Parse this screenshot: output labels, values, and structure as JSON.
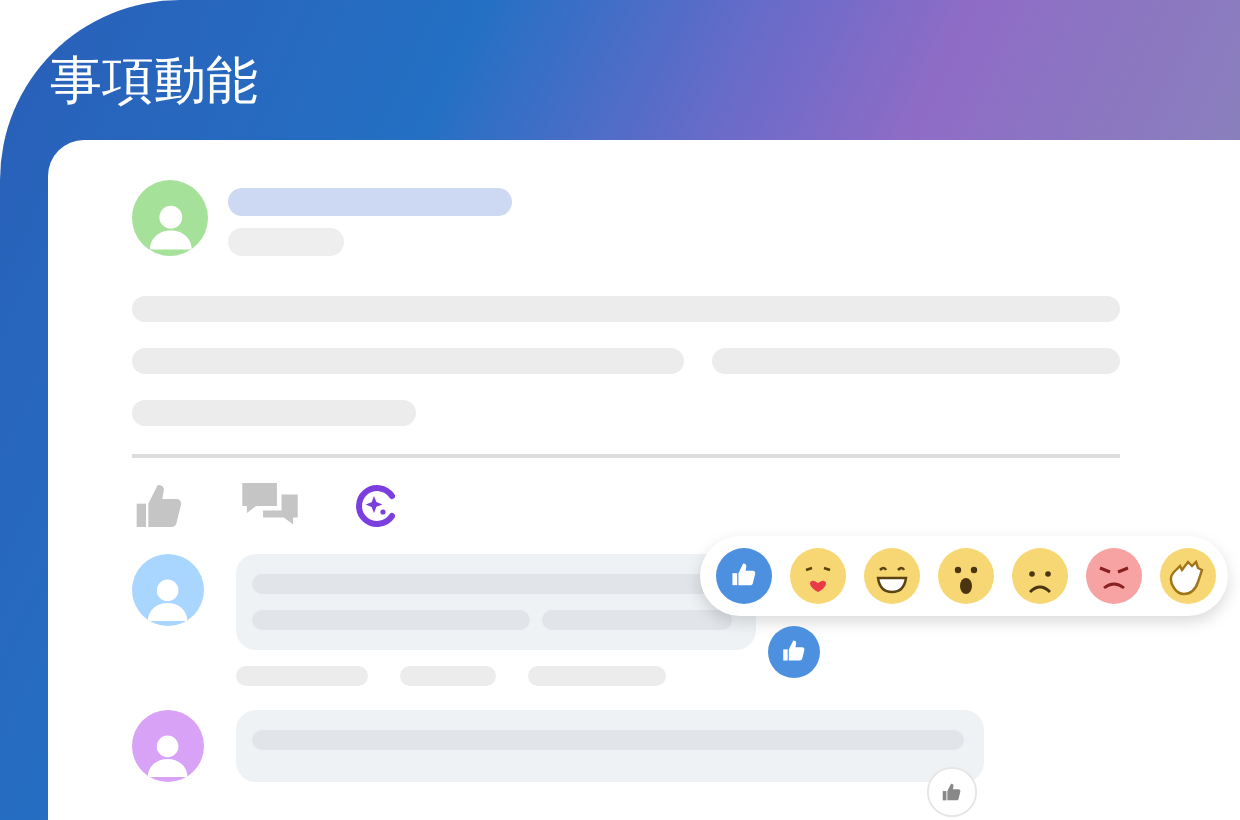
{
  "title": "事項動能",
  "post": {
    "avatar": {
      "color": "#a6e19a"
    }
  },
  "actions": [
    {
      "kind": "like"
    },
    {
      "kind": "comment"
    },
    {
      "kind": "spark"
    }
  ],
  "comments": [
    {
      "avatar": {
        "color": "#a9d6ff"
      }
    },
    {
      "avatar": {
        "color": "#d8a2f6"
      }
    }
  ],
  "reactions": [
    {
      "kind": "like"
    },
    {
      "kind": "kiss"
    },
    {
      "kind": "grin"
    },
    {
      "kind": "wow"
    },
    {
      "kind": "sad"
    },
    {
      "kind": "angry"
    },
    {
      "kind": "wave"
    }
  ]
}
